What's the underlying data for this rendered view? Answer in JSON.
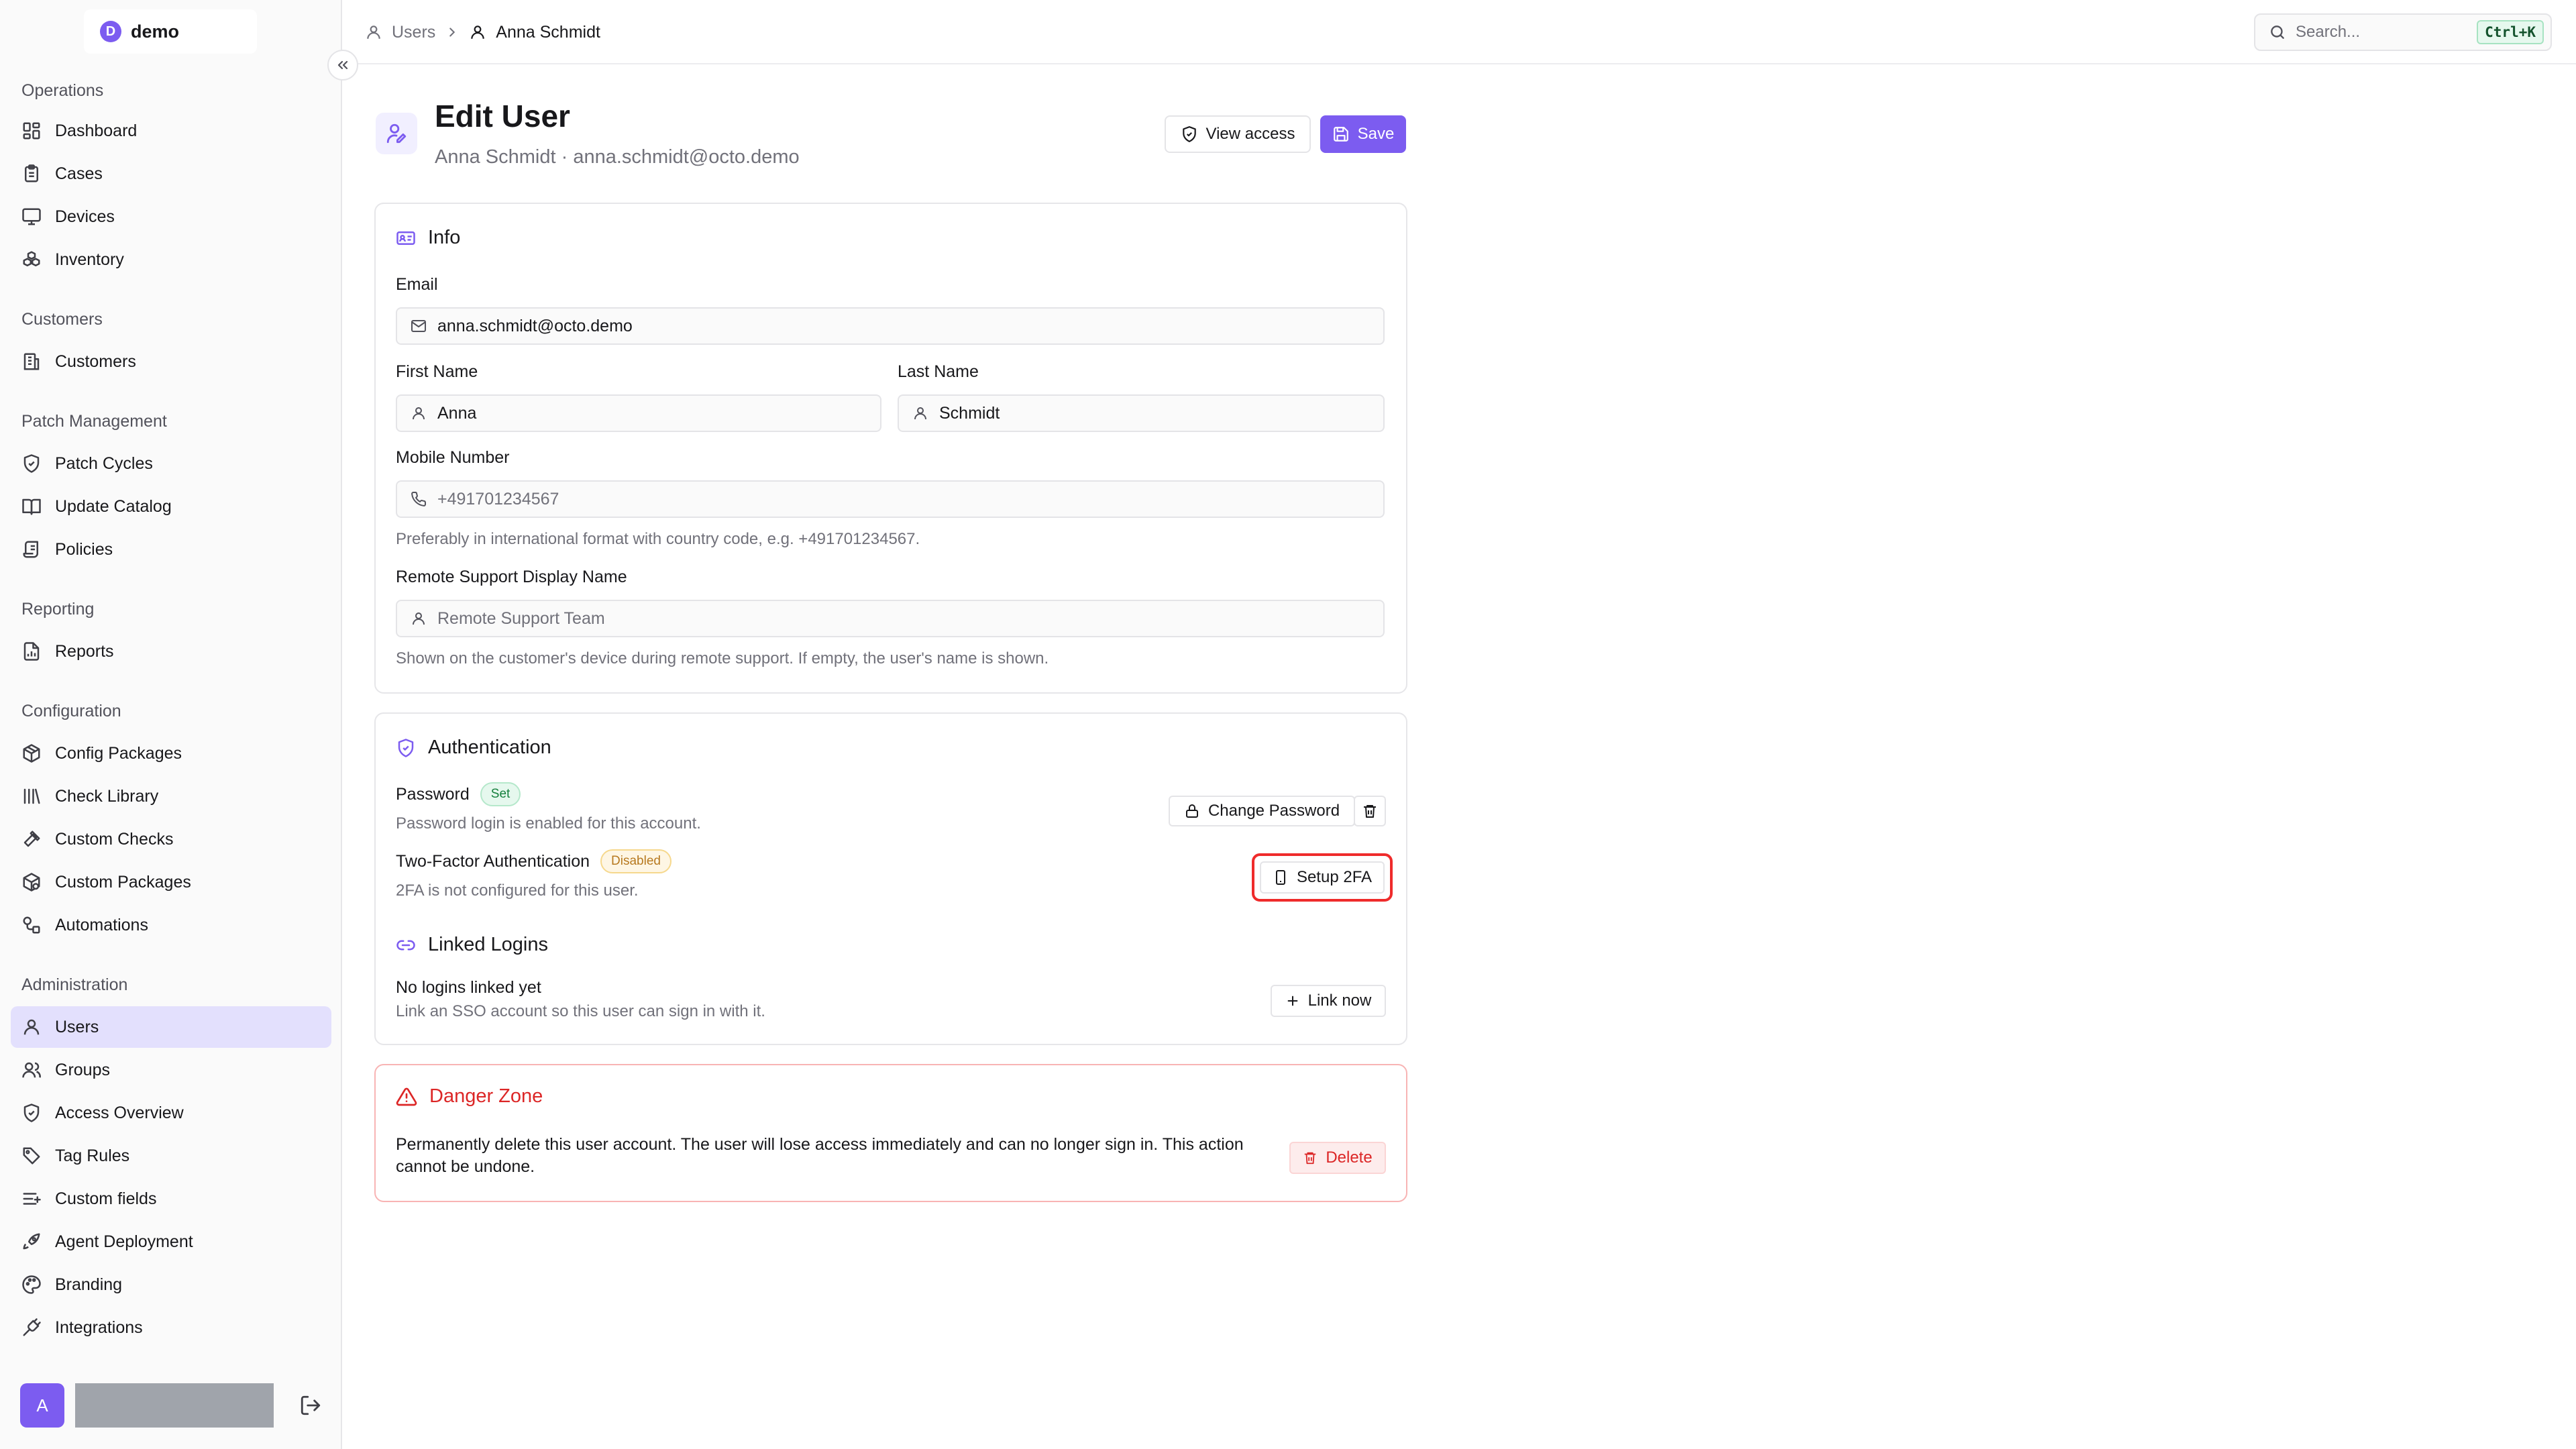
{
  "app": {
    "logo_letter": "D",
    "workspace_name": "demo"
  },
  "sidebar": {
    "groups": [
      {
        "label": "Operations",
        "items": [
          {
            "label": "Dashboard",
            "icon": "dashboard-icon"
          },
          {
            "label": "Cases",
            "icon": "clipboard-icon"
          },
          {
            "label": "Devices",
            "icon": "monitor-icon"
          },
          {
            "label": "Inventory",
            "icon": "boxes-icon"
          }
        ]
      },
      {
        "label": "Customers",
        "items": [
          {
            "label": "Customers",
            "icon": "building-icon"
          }
        ]
      },
      {
        "label": "Patch Management",
        "items": [
          {
            "label": "Patch Cycles",
            "icon": "shield-icon"
          },
          {
            "label": "Update Catalog",
            "icon": "book-icon"
          },
          {
            "label": "Policies",
            "icon": "scroll-icon"
          }
        ]
      },
      {
        "label": "Reporting",
        "items": [
          {
            "label": "Reports",
            "icon": "report-icon"
          }
        ]
      },
      {
        "label": "Configuration",
        "items": [
          {
            "label": "Config Packages",
            "icon": "package-icon"
          },
          {
            "label": "Check Library",
            "icon": "library-icon"
          },
          {
            "label": "Custom Checks",
            "icon": "hammer-icon"
          },
          {
            "label": "Custom Packages",
            "icon": "packages-icon"
          },
          {
            "label": "Automations",
            "icon": "workflow-icon"
          }
        ]
      },
      {
        "label": "Administration",
        "items": [
          {
            "label": "Users",
            "icon": "user-icon",
            "active": true
          },
          {
            "label": "Groups",
            "icon": "users-icon"
          },
          {
            "label": "Access Overview",
            "icon": "shield-check-icon"
          },
          {
            "label": "Tag Rules",
            "icon": "tag-icon"
          },
          {
            "label": "Custom fields",
            "icon": "list-icon"
          },
          {
            "label": "Agent Deployment",
            "icon": "rocket-icon"
          },
          {
            "label": "Branding",
            "icon": "palette-icon"
          },
          {
            "label": "Integrations",
            "icon": "plug-icon"
          }
        ]
      }
    ],
    "footer": {
      "avatar_letter": "A"
    }
  },
  "breadcrumb": {
    "parent": "Users",
    "current": "Anna Schmidt"
  },
  "search": {
    "placeholder": "Search...",
    "shortcut": "Ctrl+K"
  },
  "page": {
    "title": "Edit User",
    "subtitle": "Anna Schmidt · anna.schmidt@octo.demo",
    "view_access_label": "View access",
    "save_label": "Save"
  },
  "info": {
    "title": "Info",
    "email_label": "Email",
    "email_value": "anna.schmidt@octo.demo",
    "first_name_label": "First Name",
    "first_name_value": "Anna",
    "last_name_label": "Last Name",
    "last_name_value": "Schmidt",
    "mobile_label": "Mobile Number",
    "mobile_placeholder": "+491701234567",
    "mobile_help": "Preferably in international format with country code, e.g. +491701234567.",
    "remote_label": "Remote Support Display Name",
    "remote_placeholder": "Remote Support Team",
    "remote_help": "Shown on the customer's device during remote support. If empty, the user's name is shown."
  },
  "auth": {
    "title": "Authentication",
    "password_label": "Password",
    "password_badge": "Set",
    "password_desc": "Password login is enabled for this account.",
    "change_password_label": "Change Password",
    "twofa_label": "Two-Factor Authentication",
    "twofa_badge": "Disabled",
    "twofa_desc": "2FA is not configured for this user.",
    "setup_2fa_label": "Setup 2FA",
    "linked_title": "Linked Logins",
    "linked_empty": "No logins linked yet",
    "linked_desc": "Link an SSO account so this user can sign in with it.",
    "link_now_label": "Link now"
  },
  "danger": {
    "title": "Danger Zone",
    "text": "Permanently delete this user account. The user will lose access immediately and can no longer sign in. This action cannot be undone.",
    "delete_label": "Delete"
  },
  "colors": {
    "accent": "#7c5cf0",
    "active_nav_bg": "#e3e0fd",
    "danger": "#dc2626",
    "focus_ring": "#ef2b2b",
    "badge_set": "#15803d",
    "badge_disabled": "#b7791f"
  }
}
